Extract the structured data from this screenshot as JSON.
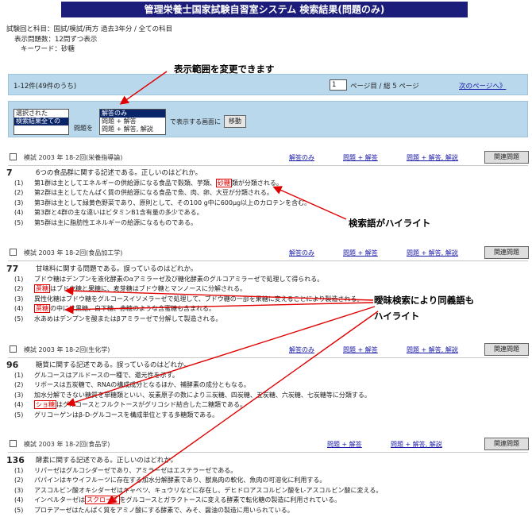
{
  "title": "管理栄養士国家試験自習室システム 検索結果(問題のみ)",
  "search_info": {
    "round_label": "試験回と科目：",
    "round_value": "国試/模試/両方 過去3年分 / 全ての科目",
    "count_label": "表示問題数：",
    "count_value": "12問ずつ表示",
    "keyword_label": "キーワード：",
    "keyword_value": "砂糖"
  },
  "annotations": {
    "range": "表示範囲を変更できます",
    "highlight": "検索語がハイライト",
    "synonym_line1": "曖昧検索により同義語も",
    "synonym_line2": "ハイライト"
  },
  "nav": {
    "range": "1-12件(49件のうち)",
    "page_value": "1",
    "page_suffix": "ページ目 / 総 5 ページ",
    "next": "次のページへ》"
  },
  "display": {
    "scope_options": [
      "選択された",
      "検索結果全ての"
    ],
    "scope_suffix": "問題を",
    "format_options": [
      "解答のみ",
      "問題 + 解答",
      "問題 + 解答, 解説"
    ],
    "format_suffix": "で表示する画面に",
    "move_button": "移動"
  },
  "links": {
    "answer_only": "解答のみ",
    "q_and_a": "問題 + 解答",
    "q_a_expl": "問題 + 解答, 解説",
    "related": "関連問題"
  },
  "questions": [
    {
      "source": "模試 2003 年 18-2回(栄養指導論)",
      "number": "7",
      "stem": "6つの食品群に関する記述である。正しいのはどれか。",
      "choices": [
        {
          "no": "(1)",
          "before": "第1群は主としてエネルギーの供給源になる食品で穀類、芋類、",
          "hl": "砂糖",
          "after": "類が分類される。"
        },
        {
          "no": "(2)",
          "before": "",
          "hl": "",
          "after": "第2群は主としてたんぱく質の供給源になる食品で魚、肉、卵、大豆が分類される。"
        },
        {
          "no": "(3)",
          "before": "",
          "hl": "",
          "after": "第3群は主として緑黄色野菜であり、原則として、その100 g中に600μg以上のカロテンを含む。"
        },
        {
          "no": "(4)",
          "before": "",
          "hl": "",
          "after": "第3群と4群の主な違いはビタミンB1含有量の多少である。"
        },
        {
          "no": "(5)",
          "before": "",
          "hl": "",
          "after": "第5群は主に脂肪性エネルギーの給源になるものである。"
        }
      ]
    },
    {
      "source": "模試 2003 年 18-2回(食品加工学)",
      "number": "77",
      "stem": "甘味料に関する問題である。誤っているのはどれか。",
      "choices": [
        {
          "no": "(1)",
          "before": "",
          "hl": "",
          "after": "ブドウ糖はデンプンを液化酵素のαアミラーゼ及び糖化酵素のグルコアミラーゼで処理して得られる。"
        },
        {
          "no": "(2)",
          "before": "",
          "hl": "蔗糖",
          "after": "はブドウ糖と果糖に、麦芽糖はブドウ糖とマンノースに分解される。"
        },
        {
          "no": "(3)",
          "before": "",
          "hl": "",
          "after": "異性化糖はブドウ糖をグルコースイソメラーゼで処理して、ブドウ糖の一部を果糖に変えることにより製造される。"
        },
        {
          "no": "(4)",
          "before": "",
          "hl": "蔗糖",
          "after": "の中には黒糖、白下糖、赤糖のような含蜜糖も含まれる。"
        },
        {
          "no": "(5)",
          "before": "",
          "hl": "",
          "after": "水あめはデンプンを酸またはβアミラーゼで分解して製造される。"
        }
      ]
    },
    {
      "source": "模試 2003 年 18-2回(生化学)",
      "number": "96",
      "stem": "糖質に関する記述である。誤っているのはどれか。",
      "choices": [
        {
          "no": "(1)",
          "before": "",
          "hl": "",
          "after": "グルコースはアルドースの一種で、還元性を示す。"
        },
        {
          "no": "(2)",
          "before": "",
          "hl": "",
          "after": "リボースは五炭糖で、RNAの構成成分となるほか、補酵素の成分ともなる。"
        },
        {
          "no": "(3)",
          "before": "",
          "hl": "",
          "after": "加水分解できない糖質を単糖類といい、炭素原子の数により三炭糖、四炭糖、五炭糖、六炭糖、七炭糖等に分類する。"
        },
        {
          "no": "(4)",
          "before": "",
          "hl": "ショ糖",
          "after": "はグルコースとフルクトースがグリコシド結合した二糖類である。"
        },
        {
          "no": "(5)",
          "before": "",
          "hl": "",
          "after": "グリコーゲンはβ-D-グルコースを構成単位とする多糖類である。"
        }
      ]
    },
    {
      "source": "模試 2003 年 18-2回(食品学)",
      "number": "136",
      "stem": "酵素に関する記述である。正しいのはどれか。",
      "choices": [
        {
          "no": "(1)",
          "before": "",
          "hl": "",
          "after": "リパーゼはグルコシダーゼであり、アミラーゼはエステラーゼである。"
        },
        {
          "no": "(2)",
          "before": "",
          "hl": "",
          "after": "パパインはキウイフルーツに存在する加水分解酵素であり、獣鳥肉の軟化、魚肉の可溶化に利用する。"
        },
        {
          "no": "(3)",
          "before": "",
          "hl": "",
          "after": "アスコルビン酸オキシダーゼはキャベツ、キュウリなどに存在し、デヒドロアスコルビン酸をL-アスコルビン酸に変える。"
        },
        {
          "no": "(4)",
          "before": "インベルターゼは",
          "hl": "スクロース",
          "after": "をグルコースとガラクトースに変える酵素で転化糖の製造に利用されている。"
        },
        {
          "no": "(5)",
          "before": "",
          "hl": "",
          "after": "プロテアーゼはたんぱく質をアミノ酸にする酵素で、みそ、醤油の製造に用いられている。"
        }
      ]
    }
  ]
}
